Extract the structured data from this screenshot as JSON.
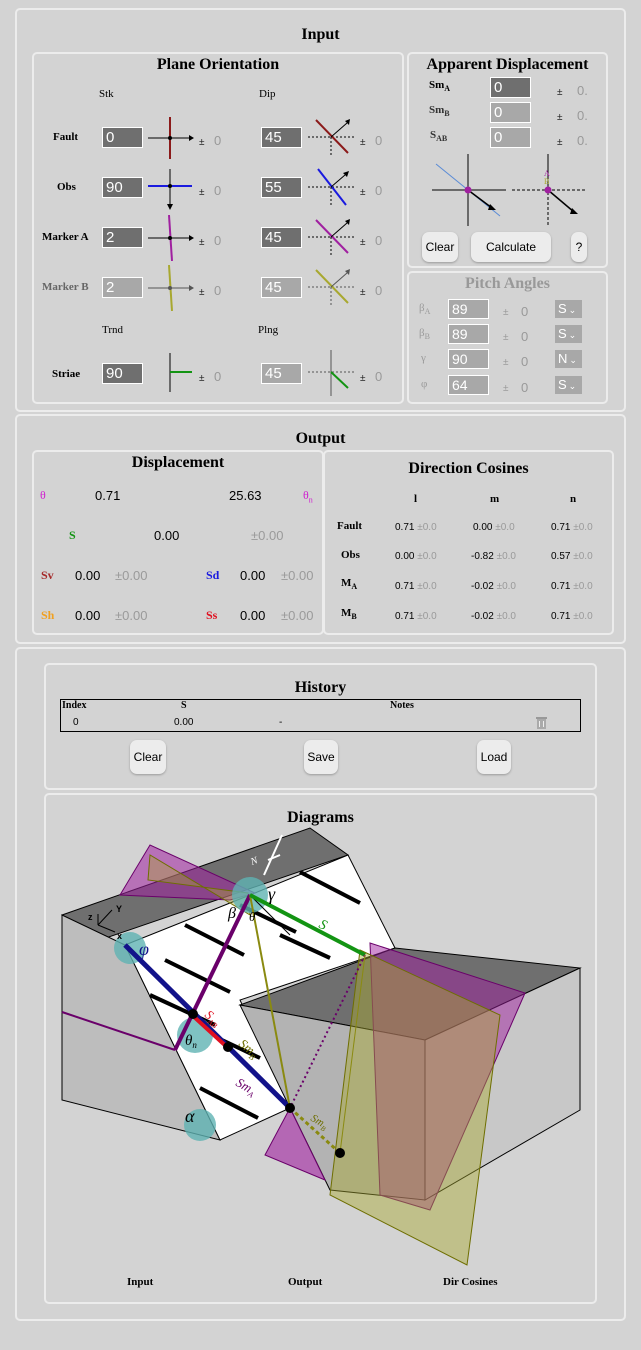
{
  "input": {
    "title": "Input",
    "plane": {
      "title": "Plane Orientation",
      "col_stk": "Stk",
      "col_dip": "Dip",
      "col_trnd": "Trnd",
      "col_plng": "Plng",
      "rows": [
        {
          "label": "Fault",
          "stk": "0",
          "stk_err": "0",
          "dip": "45",
          "dip_err": "0"
        },
        {
          "label": "Obs",
          "stk": "90",
          "stk_err": "0",
          "dip": "55",
          "dip_err": "0"
        },
        {
          "label": "Marker A",
          "stk": "2",
          "stk_err": "0",
          "dip": "45",
          "dip_err": "0"
        },
        {
          "label": "Marker B",
          "stk": "2",
          "stk_err": "0",
          "dip": "45",
          "dip_err": "0"
        }
      ],
      "striae": {
        "label": "Striae",
        "trnd": "90",
        "trnd_err": "0",
        "plng": "45",
        "plng_err": "0"
      }
    },
    "apparent": {
      "title": "Apparent Displacement",
      "sma": {
        "label": "Sm",
        "sub": "A",
        "value": "0",
        "err": "0."
      },
      "smb": {
        "label": "Sm",
        "sub": "B",
        "value": "0",
        "err": "0."
      },
      "sab": {
        "label": "S",
        "sub": "AB",
        "value": "0",
        "err": "0."
      },
      "clear": "Clear",
      "calculate": "Calculate",
      "help": "?"
    },
    "pitch": {
      "title": "Pitch Angles",
      "rows": [
        {
          "sym": "β",
          "sub": "A",
          "value": "89",
          "err": "0",
          "dir": "S"
        },
        {
          "sym": "β",
          "sub": "B",
          "value": "89",
          "err": "0",
          "dir": "S"
        },
        {
          "sym": "γ",
          "sub": "",
          "value": "90",
          "err": "0",
          "dir": "N"
        },
        {
          "sym": "φ",
          "sub": "",
          "value": "64",
          "err": "0",
          "dir": "S"
        }
      ]
    }
  },
  "output": {
    "title": "Output",
    "disp": {
      "title": "Displacement",
      "theta": "θ",
      "theta_val": "0.71",
      "theta2_val": "25.63",
      "theta_n": "θ",
      "theta_n_sub": "n",
      "s_label": "S",
      "s_val": "0.00",
      "s_err": "±0.00",
      "sv_label": "Sv",
      "sv_val": "0.00",
      "sv_err": "±0.00",
      "sd_label": "Sd",
      "sd_val": "0.00",
      "sd_err": "±0.00",
      "sh_label": "Sh",
      "sh_val": "0.00",
      "sh_err": "±0.00",
      "ss_label": "Ss",
      "ss_val": "0.00",
      "ss_err": "±0.00"
    },
    "cos": {
      "title": "Direction Cosines",
      "cols": [
        "l",
        "m",
        "n"
      ],
      "rows": [
        {
          "label": "Fault",
          "sub": "",
          "l": "0.71",
          "le": "±0.0",
          "m": "0.00",
          "me": "±0.0",
          "n": "0.71",
          "ne": "±0.0"
        },
        {
          "label": "Obs",
          "sub": "",
          "l": "0.00",
          "le": "±0.0",
          "m": "-0.82",
          "me": "±0.0",
          "n": "0.57",
          "ne": "±0.0"
        },
        {
          "label": "M",
          "sub": "A",
          "l": "0.71",
          "le": "±0.0",
          "m": "-0.02",
          "me": "±0.0",
          "n": "0.71",
          "ne": "±0.0"
        },
        {
          "label": "M",
          "sub": "B",
          "l": "0.71",
          "le": "±0.0",
          "m": "-0.02",
          "me": "±0.0",
          "n": "0.71",
          "ne": "±0.0"
        }
      ]
    }
  },
  "history": {
    "title": "History",
    "cols": [
      "Index",
      "S",
      "Notes"
    ],
    "row": {
      "index": "0",
      "s": "0.00",
      "notes": "-"
    },
    "clear": "Clear",
    "save": "Save",
    "load": "Load"
  },
  "diagrams": {
    "title": "Diagrams",
    "tabs": [
      "Input",
      "Output",
      "Dir Cosines"
    ],
    "labels": {
      "phi": "φ",
      "beta": "β",
      "gamma": "γ",
      "theta": "θ",
      "theta_n": "θ",
      "theta_n_sub": "n",
      "alpha": "α",
      "s": "S",
      "sab": "S",
      "sab_sub": "AB",
      "smb": "Sm",
      "smb_sub": "B",
      "sma": "Sm",
      "sma_sub": "A",
      "smb2": "Sm",
      "smb2_sub": "B",
      "north": "N",
      "x": "x",
      "y": "Y",
      "z": "z"
    }
  },
  "colors": {
    "fault": "#8b1a1a",
    "obs": "#1a1adf",
    "markerA": "#a020a0",
    "markerB": "#a8a830",
    "striae": "#139413",
    "theta": "#d020d0",
    "sv": "#a52a2a",
    "sh": "#f0a020",
    "sd": "#1a1adf",
    "ss": "#e01020"
  }
}
